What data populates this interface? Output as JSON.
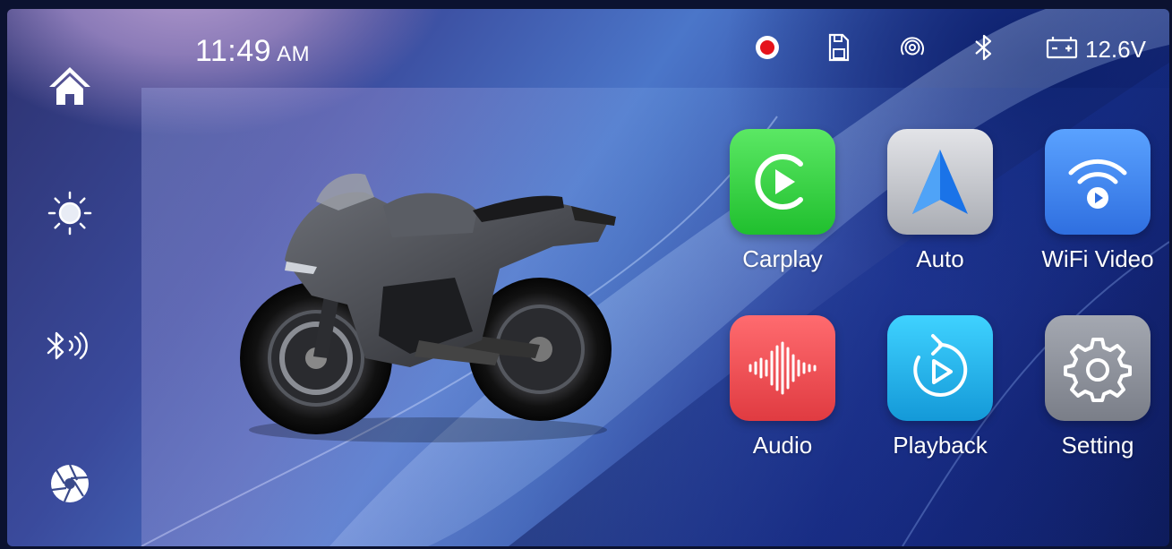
{
  "status_bar": {
    "time": "11:49",
    "ampm": "AM",
    "voltage": "12.6V",
    "icons": [
      "record-icon",
      "sd-card-icon",
      "wireless-signal-icon",
      "bluetooth-icon",
      "battery-icon"
    ],
    "record_color": "#e5131b"
  },
  "sidebar": {
    "items": [
      {
        "name": "home-icon"
      },
      {
        "name": "brightness-icon"
      },
      {
        "name": "bluetooth-audio-icon"
      },
      {
        "name": "camera-shutter-icon"
      }
    ]
  },
  "hero": {
    "image": "sport-motorcycle"
  },
  "apps": [
    {
      "label": "Carplay",
      "icon": "carplay-icon",
      "color": "#2fd13a"
    },
    {
      "label": "Auto",
      "icon": "android-auto-icon",
      "color": "#c9cbd0"
    },
    {
      "label": "WiFi Video",
      "icon": "wifi-video-icon",
      "color": "#3b86ee"
    },
    {
      "label": "Audio",
      "icon": "audio-waveform-icon",
      "color": "#ef4a4f"
    },
    {
      "label": "Playback",
      "icon": "playback-icon",
      "color": "#1eb6ec"
    },
    {
      "label": "Setting",
      "icon": "settings-gear-icon",
      "color": "#8a8f99"
    }
  ]
}
